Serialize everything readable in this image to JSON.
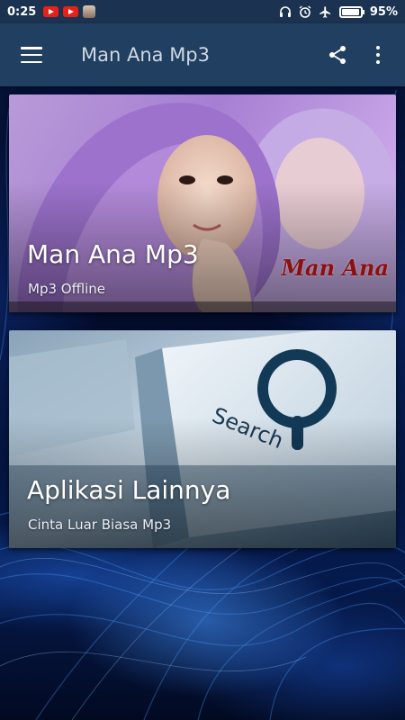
{
  "status_bar": {
    "time": "0:25",
    "battery": "95%",
    "icons": [
      "youtube-icon",
      "youtube-icon",
      "user-avatar-icon",
      "headphones-icon",
      "alarm-icon",
      "airplane-mode-icon",
      "battery-icon"
    ]
  },
  "app_bar": {
    "title": "Man Ana Mp3",
    "icons": [
      "menu-icon",
      "share-icon",
      "more-vert-icon"
    ]
  },
  "cards": [
    {
      "title": "Man Ana Mp3",
      "subtitle": "Mp3 Offline",
      "image_text": "Man Ana"
    },
    {
      "title": "Aplikasi Lainnya",
      "subtitle": "Cinta Luar Biasa Mp3",
      "image_text": "Search"
    }
  ],
  "colors": {
    "status_bar": "#1b3350",
    "app_bar": "#213f60",
    "background": "#06163f",
    "image_text_red": "#8b1010"
  }
}
